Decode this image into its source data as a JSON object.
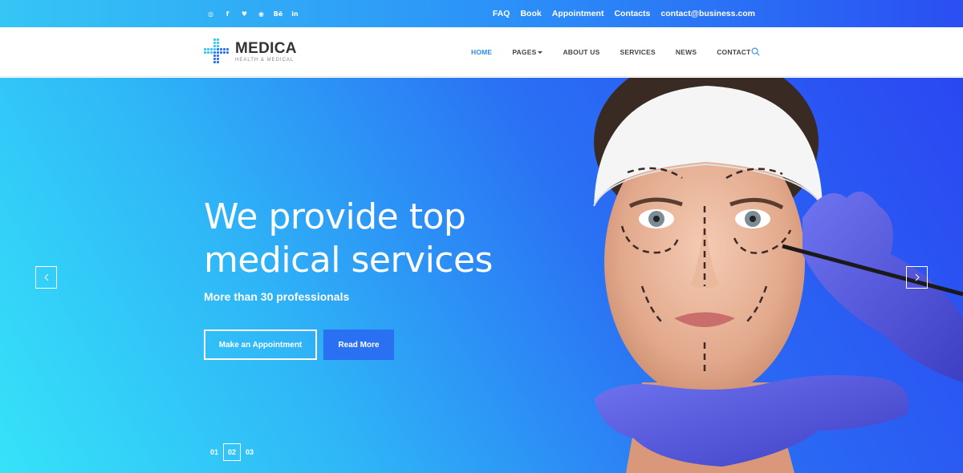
{
  "topbar": {
    "social": [
      "◎",
      "f",
      "♥",
      "◉",
      "Bē",
      "in"
    ],
    "links": [
      "FAQ",
      "Book",
      "Appointment",
      "Contacts",
      "contact@business.com"
    ]
  },
  "logo": {
    "name": "MEDICA",
    "tagline": "HEALTH & MEDICAL"
  },
  "nav": {
    "items": [
      "HOME",
      "PAGES",
      "ABOUT US",
      "SERVICES",
      "NEWS",
      "CONTACT"
    ]
  },
  "hero": {
    "headline_line1": "We provide top",
    "headline_line2": "medical services",
    "subtitle": "More than 30 professionals",
    "primary_button": "Make an Appointment",
    "secondary_button": "Read More",
    "slides": [
      "01",
      "02",
      "03"
    ],
    "active_slide": "02"
  },
  "colors": {
    "accent": "#2d8cf0",
    "button": "#2a70f2",
    "gradient_start": "#36e3f8",
    "gradient_end": "#2a47f2"
  }
}
